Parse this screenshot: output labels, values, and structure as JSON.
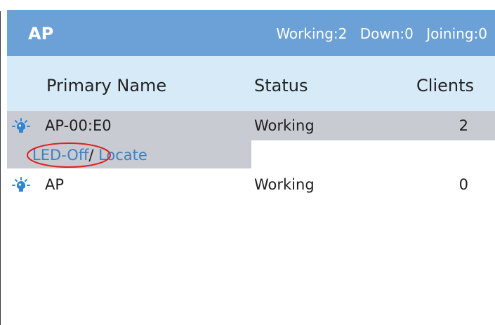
{
  "header": {
    "title": "AP",
    "working": "Working:2",
    "down": "Down:0",
    "joining": "Joining:0"
  },
  "columns": {
    "name": "Primary Name",
    "status": "Status",
    "clients": "Clients"
  },
  "rows": [
    {
      "name": "AP-00:E0",
      "status": "Working",
      "clients": "2",
      "selected": true
    },
    {
      "name": "AP",
      "status": "Working",
      "clients": "0",
      "selected": false
    }
  ],
  "actions": {
    "led_off": "LED-Off",
    "separator": "/",
    "locate": "Locate"
  },
  "colors": {
    "header_bg": "#6ba1d6",
    "column_header_bg": "#d6eaf8",
    "selected_row_bg": "#c8cbd2",
    "link": "#3f7fc0",
    "annotation": "#e02020"
  },
  "icons": {
    "row_status": "led-light-icon"
  }
}
